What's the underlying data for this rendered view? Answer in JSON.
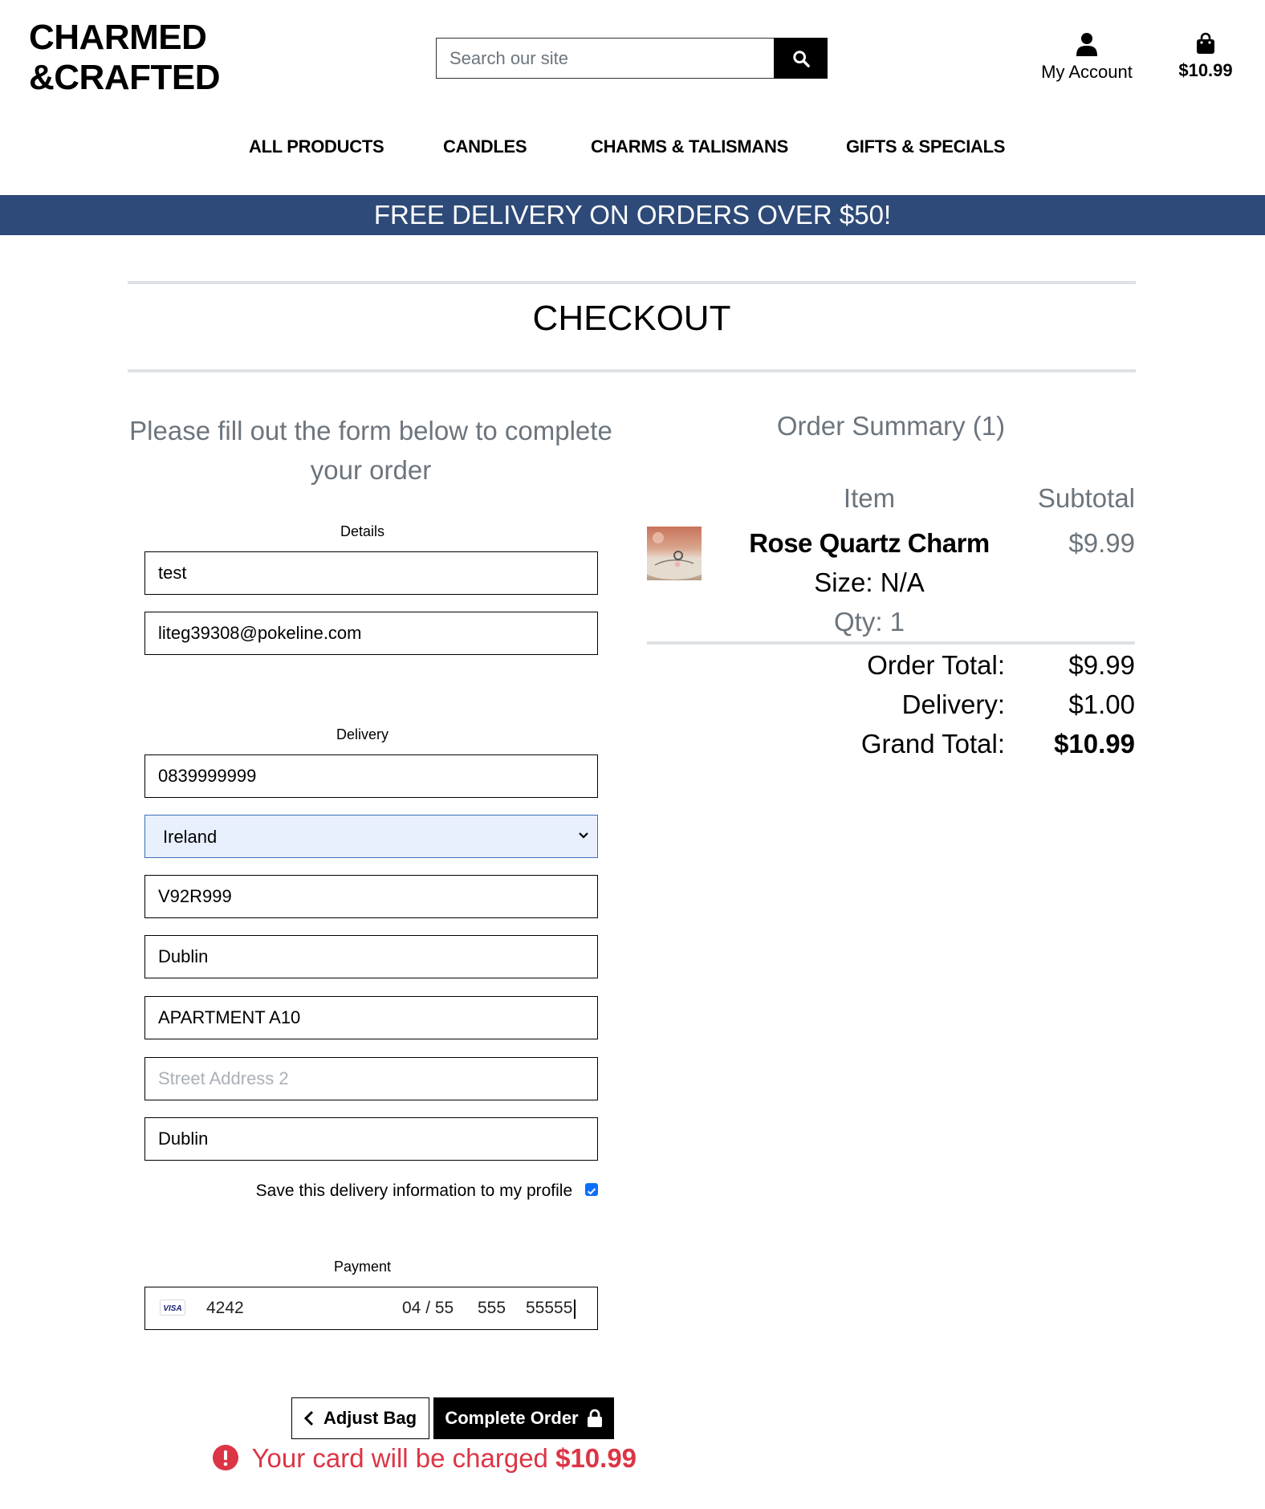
{
  "header": {
    "logo_line1": "CHARMED",
    "logo_line2": "&CRAFTED",
    "search_placeholder": "Search our site",
    "account_label": "My Account",
    "bag_total": "$10.99"
  },
  "nav": [
    {
      "label": "ALL PRODUCTS"
    },
    {
      "label": "CANDLES"
    },
    {
      "label": "CHARMS & TALISMANS"
    },
    {
      "label": "GIFTS & SPECIALS"
    }
  ],
  "banner": {
    "text": "FREE DELIVERY ON ORDERS OVER $50!",
    "color": "#2e4a78"
  },
  "page_title": "CHECKOUT",
  "form": {
    "intro": "Please fill out the form below to complete your order",
    "details_legend": "Details",
    "full_name": "test",
    "email": "liteg39308@pokeline.com",
    "delivery_legend": "Delivery",
    "phone": "0839999999",
    "country": "Ireland",
    "postcode": "V92R999",
    "town": "Dublin",
    "street1": "APARTMENT A10",
    "street2_placeholder": "Street Address 2",
    "county": "Dublin",
    "save_label": "Save this delivery information to my profile",
    "save_checked": true,
    "payment_legend": "Payment",
    "card_number": "4242",
    "card_expiry": "04 / 55",
    "card_cvc": "555",
    "card_zip": "55555",
    "card_brand_icon": "visa-icon"
  },
  "actions": {
    "adjust_label": "Adjust Bag",
    "complete_label": "Complete Order",
    "charge_text": "Your card will be charged",
    "charge_amount": "$10.99",
    "alert_color": "#dc3545"
  },
  "summary": {
    "title": "Order Summary (1)",
    "col_item": "Item",
    "col_subtotal": "Subtotal",
    "items": [
      {
        "name": "Rose Quartz Charm",
        "size": "Size: N/A",
        "qty": "Qty: 1",
        "subtotal": "$9.99"
      }
    ],
    "order_total_label": "Order Total:",
    "order_total": "$9.99",
    "delivery_label": "Delivery:",
    "delivery": "$1.00",
    "grand_total_label": "Grand Total:",
    "grand_total": "$10.99"
  }
}
